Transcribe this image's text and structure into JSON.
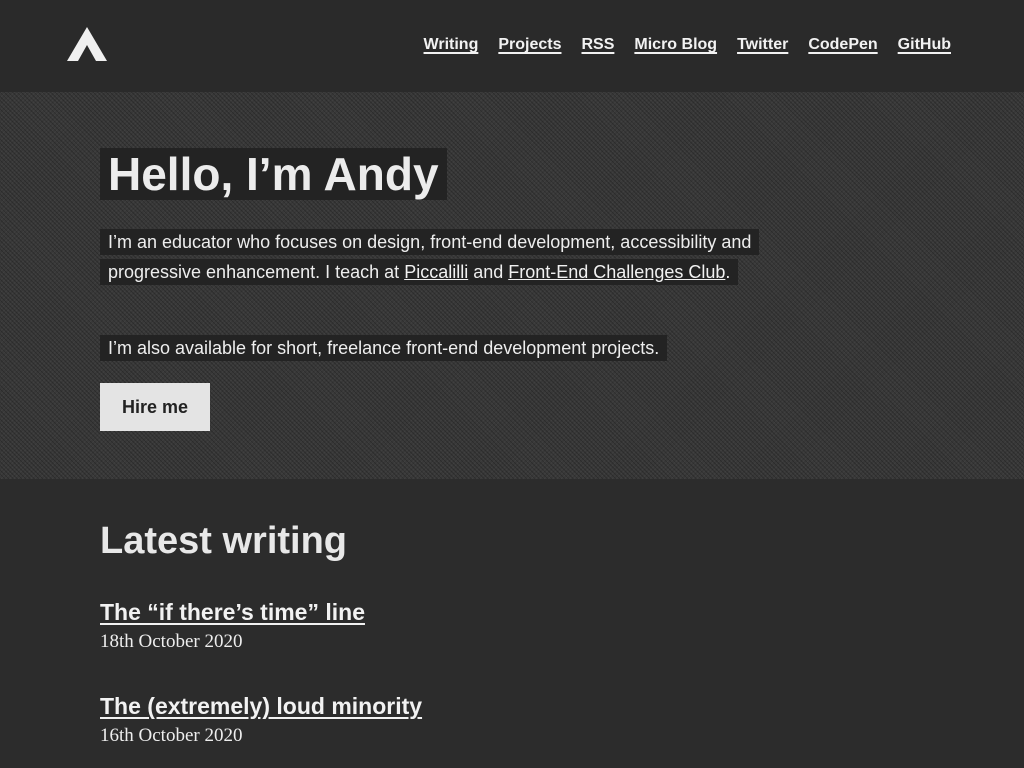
{
  "header": {
    "nav": [
      {
        "label": "Writing"
      },
      {
        "label": "Projects"
      },
      {
        "label": "RSS"
      },
      {
        "label": "Micro Blog"
      },
      {
        "label": "Twitter"
      },
      {
        "label": "CodePen"
      },
      {
        "label": "GitHub"
      }
    ]
  },
  "intro": {
    "heading": "Hello, I’m Andy",
    "bio_text_1": "I’m an educator who focuses on design, front-end development, accessibility and progressive enhancement. I teach at ",
    "link_piccalilli": "Piccalilli",
    "bio_text_2": " and ",
    "link_challenges": "Front-End Challenges Club",
    "bio_text_3": ".",
    "availability": "I’m also available for short, freelance front-end development projects.",
    "hire_label": "Hire me"
  },
  "latest": {
    "heading": "Latest writing",
    "posts": [
      {
        "title": "The “if there’s time” line",
        "date": "18th October 2020"
      },
      {
        "title": "The (extremely) loud minority",
        "date": "16th October 2020"
      }
    ]
  },
  "colors": {
    "background": "#2b2b2b",
    "intro_background": "#383838",
    "text_highlight": "#232323",
    "button": "#e4e4e4"
  }
}
